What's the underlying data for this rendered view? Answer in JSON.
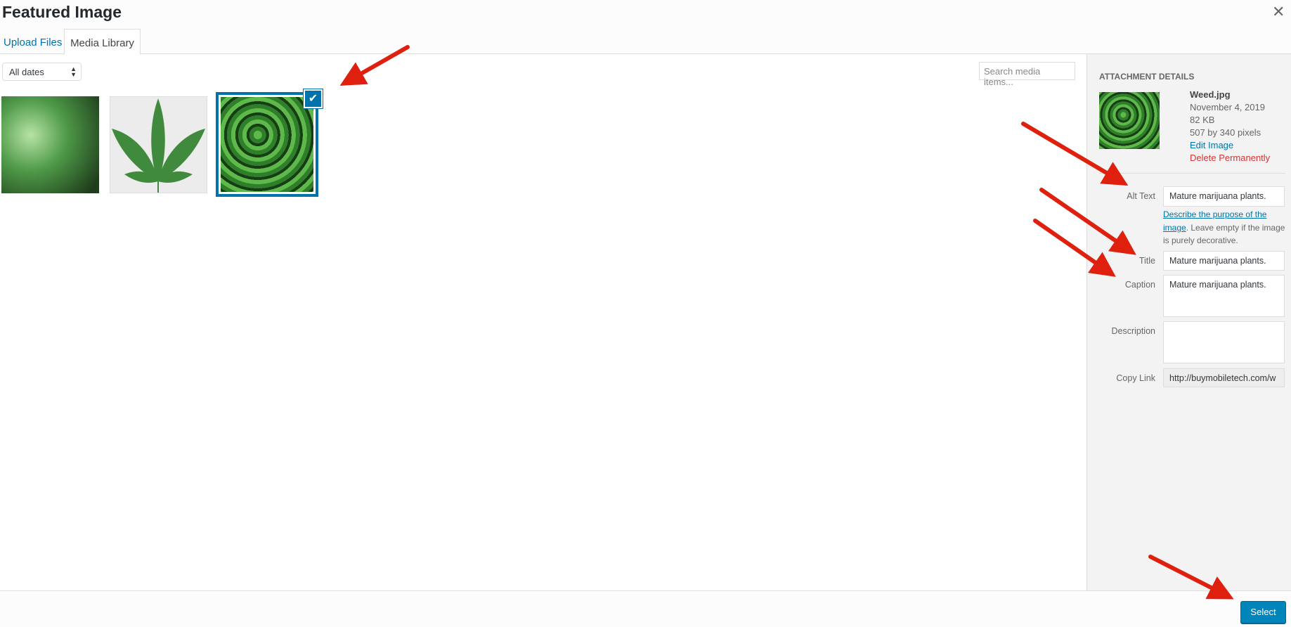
{
  "modal": {
    "title": "Featured Image",
    "close_icon": "close-icon"
  },
  "tabs": [
    {
      "label": "Upload Files"
    },
    {
      "label": "Media Library",
      "active": true
    }
  ],
  "filter": {
    "date_select": "All dates"
  },
  "search": {
    "placeholder": "Search media items..."
  },
  "media_items": [
    {
      "selected": false
    },
    {
      "selected": false
    },
    {
      "selected": true
    }
  ],
  "details": {
    "heading": "Attachment Details",
    "filename": "Weed.jpg",
    "date": "November 4, 2019",
    "size": "82 KB",
    "dimensions": "507 by 340 pixels",
    "edit_link": "Edit Image",
    "delete_link": "Delete Permanently",
    "fields": {
      "alt_label": "Alt Text",
      "alt_value": "Mature marijuana plants.",
      "help_link": "Describe the purpose of the image",
      "help_text": ". Leave empty if the image is purely decorative.",
      "title_label": "Title",
      "title_value": "Mature marijuana plants.",
      "caption_label": "Caption",
      "caption_value": "Mature marijuana plants.",
      "description_label": "Description",
      "description_value": "",
      "copy_label": "Copy Link",
      "copy_value": "http://buymobiletech.com/w"
    }
  },
  "footer": {
    "select_label": "Select"
  },
  "colors": {
    "accent": "#0073aa",
    "button": "#0085ba",
    "delete": "#dc3232",
    "arrow": "#e0200f"
  }
}
